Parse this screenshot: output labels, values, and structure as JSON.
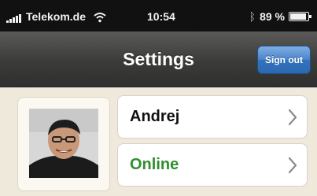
{
  "status_bar": {
    "carrier": "Telekom.de",
    "time": "10:54",
    "battery_percent": "89 %",
    "battery_level": 0.89,
    "signal_icon": "signal-bars-icon",
    "wifi_icon": "wifi-icon",
    "bluetooth_icon": "bluetooth-icon",
    "battery_icon": "battery-icon"
  },
  "nav": {
    "title": "Settings",
    "sign_out_label": "Sign out"
  },
  "profile": {
    "avatar_icon": "user-photo",
    "name": "Andrej",
    "status": "Online",
    "status_color": "#2f8f2f",
    "chevron_icon": "chevron-right-icon"
  },
  "colors": {
    "status_bar_bg": "#111111",
    "nav_bg": "#3b3b3a",
    "accent_blue": "#3272bd",
    "content_bg": "#efe9dc"
  }
}
